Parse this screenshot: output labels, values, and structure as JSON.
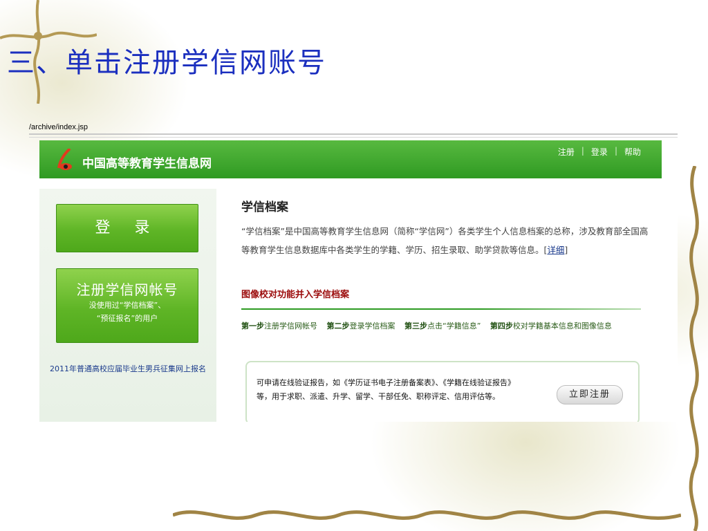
{
  "slide": {
    "title": "三、单击注册学信网账号"
  },
  "browser": {
    "url": "/archive/index.jsp"
  },
  "site": {
    "name": "中国高等教育学生信息网",
    "top_links": [
      "注册",
      "登录",
      "帮助"
    ],
    "sidebar": {
      "login_label": "登 录",
      "register_label": "注册学信网帐号",
      "register_sub1": "没使用过“学信档案”、",
      "register_sub2": "“预征报名”的用户",
      "link": "2011年普通高校应届毕业生男兵征集网上报名"
    },
    "main": {
      "title": "学信档案",
      "description": "“学信档案”是中国高等教育学生信息网（简称“学信网”）各类学生个人信息档案的总称，涉及教育部全国高等教育学生信息数据库中各类学生的学籍、学历、招生录取、助学贷款等信息。",
      "more_link": "详细",
      "merge_title": "图像校对功能并入学信档案",
      "steps": [
        {
          "label": "第一步",
          "text": "注册学信网帐号"
        },
        {
          "label": "第二步",
          "text": "登录学信档案"
        },
        {
          "label": "第三步",
          "text": "点击“学籍信息”"
        },
        {
          "label": "第四步",
          "text": "校对学籍基本信息和图像信息"
        }
      ],
      "promo_line1": "可申请在线验证报告，如《学历证书电子注册备案表》、《学籍在线验证报告》",
      "promo_line2": "等，用于求职、派遣、升学、留学、干部任免、职称评定、信用评估等。",
      "register_now": "立即注册"
    }
  },
  "colors": {
    "title_blue": "#1b2fbf",
    "header_green": "#2f9a22",
    "merge_red": "#9b0a0a"
  }
}
